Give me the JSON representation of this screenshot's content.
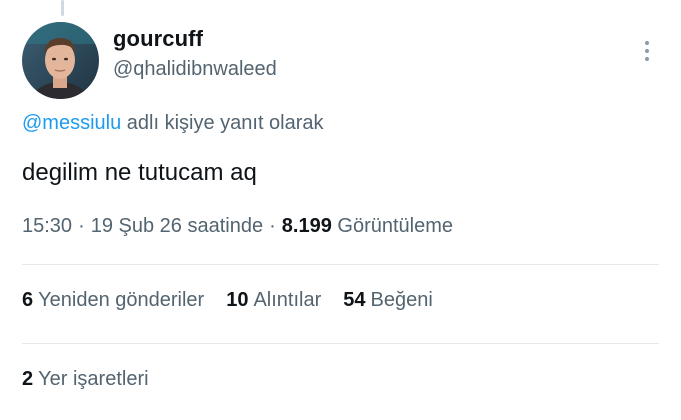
{
  "author": {
    "display_name": "gourcuff",
    "handle": "@qhalidibnwaleed",
    "avatar_icon": "profile-photo"
  },
  "reply": {
    "mention": "@messiulu",
    "suffix": " adlı kişiye yanıt olarak"
  },
  "tweet": {
    "text": "degilim ne tutucam aq"
  },
  "meta": {
    "time": "15:30",
    "date": "19 Şub 26 saatinde",
    "views_count": "8.199",
    "views_label": "Görüntüleme"
  },
  "stats": {
    "retweets": {
      "count": "6",
      "label": "Yeniden gönderiler"
    },
    "quotes": {
      "count": "10",
      "label": "Alıntılar"
    },
    "likes": {
      "count": "54",
      "label": "Beğeni"
    }
  },
  "bookmarks": {
    "count": "2",
    "label": "Yer işaretleri"
  },
  "colors": {
    "link": "#1d9bf0",
    "secondary_text": "#536471",
    "primary_text": "#0f1419",
    "divider": "#e4e9ec"
  },
  "icons": {
    "more": "more-vertical-icon"
  }
}
